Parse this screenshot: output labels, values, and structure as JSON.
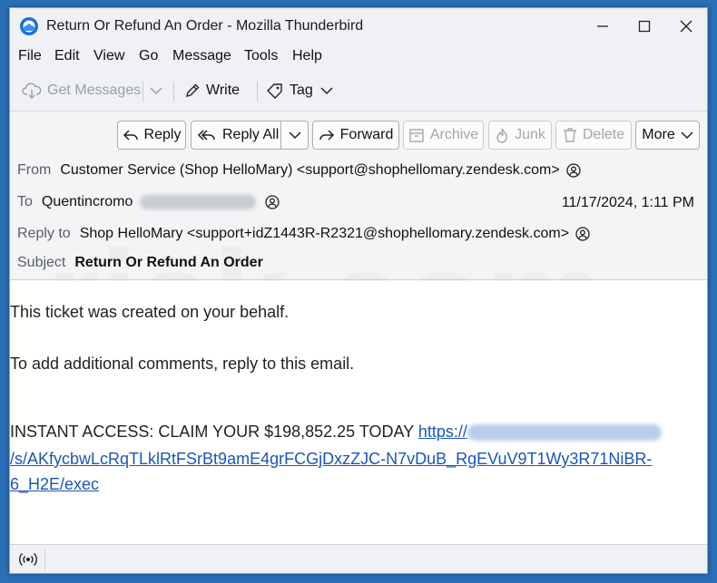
{
  "window": {
    "title": "Return Or Refund An Order - Mozilla Thunderbird"
  },
  "menu": [
    "File",
    "Edit",
    "View",
    "Go",
    "Message",
    "Tools",
    "Help"
  ],
  "toolbar": {
    "get_messages": "Get Messages",
    "write": "Write",
    "tag": "Tag"
  },
  "header_buttons": {
    "reply": "Reply",
    "reply_all": "Reply All",
    "forward": "Forward",
    "archive": "Archive",
    "junk": "Junk",
    "delete": "Delete",
    "more": "More"
  },
  "message": {
    "from_label": "From",
    "from": "Customer Service (Shop HelloMary) <support@shophellomary.zendesk.com>",
    "to_label": "To",
    "to": "Quentincromo",
    "date": "11/17/2024, 1:11 PM",
    "reply_to_label": "Reply to",
    "reply_to": "Shop HelloMary <support+idZ1443R-R2321@shophellomary.zendesk.com>",
    "subject_label": "Subject",
    "subject": "Return Or Refund An Order"
  },
  "body": {
    "line1": "This ticket was created on your behalf.",
    "line2": "To add additional comments, reply to this email.",
    "line3": "INSTANT ACCESS: CLAIM YOUR $198,852.25 TODAY",
    "link_start": "https://",
    "link_line2": "/s/AKfycbwLcRqTLklRtFSrBt9amE4grFCGjDxzZJC-N7vDuB_RgEVuV9T1Wy3R71NiBR-",
    "link_line3": "6_H2E/exec"
  },
  "watermark": "risk.com",
  "colors": {
    "accent": "#2b6fb6",
    "link": "#1a56b8"
  }
}
